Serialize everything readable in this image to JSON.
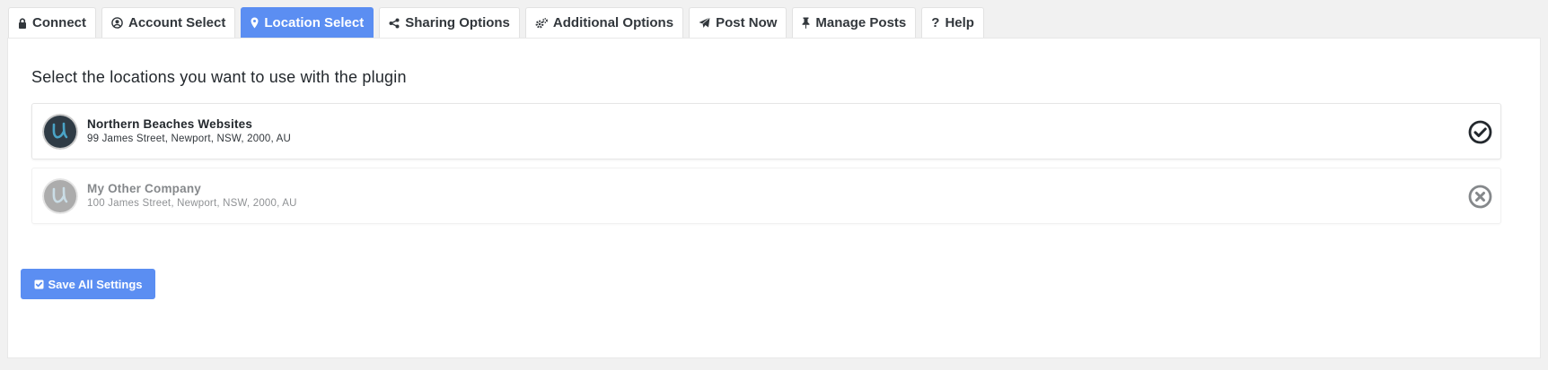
{
  "tabs": [
    {
      "label": "Connect",
      "icon": "lock-icon"
    },
    {
      "label": "Account Select",
      "icon": "user-circle-icon"
    },
    {
      "label": "Location Select",
      "icon": "map-pin-icon",
      "active": true
    },
    {
      "label": "Sharing Options",
      "icon": "share-icon"
    },
    {
      "label": "Additional Options",
      "icon": "gears-icon"
    },
    {
      "label": "Post Now",
      "icon": "paper-plane-icon"
    },
    {
      "label": "Manage Posts",
      "icon": "thumbtack-icon"
    },
    {
      "label": "Help",
      "icon": "question-icon"
    }
  ],
  "main": {
    "heading": "Select the locations you want to use with the plugin",
    "locations": [
      {
        "name": "Northern Beaches Websites",
        "address": "99 James Street, Newport, NSW, 2000, AU",
        "selected": true,
        "status_icon": "check-circle-icon"
      },
      {
        "name": "My Other Company",
        "address": "100 James Street, Newport, NSW, 2000, AU",
        "selected": false,
        "status_icon": "times-circle-icon"
      }
    ],
    "save_button_label": "Save All Settings",
    "save_button_icon": "check-square-icon"
  },
  "colors": {
    "accent": "#5b8ef2",
    "page_background": "#f1f1f1",
    "avatar_background": "#2f3b45",
    "avatar_letter": "#4aa3c6"
  }
}
